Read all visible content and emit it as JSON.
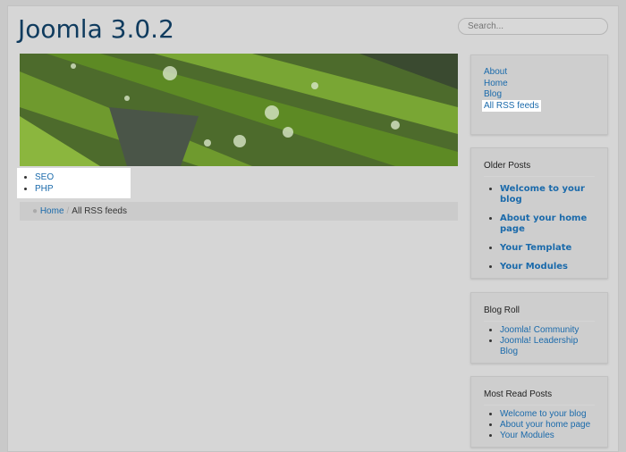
{
  "site_title": "Joomla 3.0.2",
  "search": {
    "placeholder": "Search..."
  },
  "top_menu": [
    "SEO",
    "PHP"
  ],
  "breadcrumb": {
    "home": "Home",
    "separator": "/",
    "current": "All RSS feeds"
  },
  "main_menu": [
    "About",
    "Home",
    "Blog",
    "All RSS feeds"
  ],
  "older_posts": {
    "title": "Older Posts",
    "items": [
      "Welcome to your blog",
      "About your home page",
      "Your Template",
      "Your Modules"
    ]
  },
  "blog_roll": {
    "title": "Blog Roll",
    "items": [
      "Joomla! Community",
      "Joomla! Leadership Blog"
    ]
  },
  "most_read": {
    "title": "Most Read Posts",
    "items": [
      "Welcome to your blog",
      "About your home page",
      "Your Modules"
    ]
  }
}
